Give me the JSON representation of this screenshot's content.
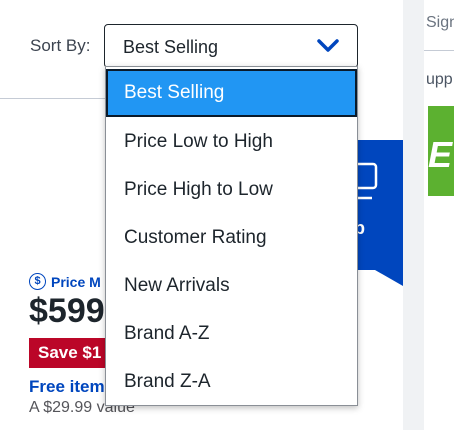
{
  "sort": {
    "label": "Sort By:",
    "selected": "Best Selling",
    "options": [
      "Best Selling",
      "Price Low to High",
      "Price High to Low",
      "Customer Rating",
      "New Arrivals",
      "Brand A-Z",
      "Brand Z-A"
    ]
  },
  "product": {
    "price_match": "Price M",
    "price": "$599",
    "save": "Save $1",
    "free_item": "Free item",
    "value": "A $29.99 value"
  },
  "banner": {
    "text": "p"
  },
  "right_panel": {
    "text1": "Sign",
    "text2": "upp",
    "green_text": "E"
  },
  "colors": {
    "accent": "#0046be",
    "selected_option": "#2196f3",
    "save_badge": "#bb0628",
    "green": "#5cb130"
  }
}
